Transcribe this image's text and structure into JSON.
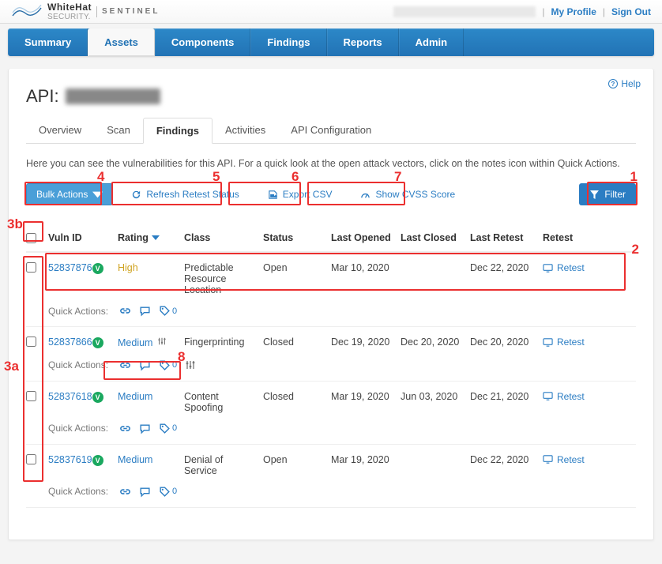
{
  "topbar": {
    "brand_name": "WhiteHat",
    "brand_sub": "SECURITY.",
    "product": "SENTINEL",
    "my_profile": "My Profile",
    "sign_out": "Sign Out"
  },
  "nav": {
    "items": [
      {
        "label": "Summary",
        "active": false
      },
      {
        "label": "Assets",
        "active": true
      },
      {
        "label": "Components",
        "active": false
      },
      {
        "label": "Findings",
        "active": false
      },
      {
        "label": "Reports",
        "active": false
      },
      {
        "label": "Admin",
        "active": false
      }
    ]
  },
  "help": {
    "label": "Help"
  },
  "page": {
    "title_prefix": "API:"
  },
  "subtabs": [
    {
      "label": "Overview",
      "active": false
    },
    {
      "label": "Scan",
      "active": false
    },
    {
      "label": "Findings",
      "active": true
    },
    {
      "label": "Activities",
      "active": false
    },
    {
      "label": "API Configuration",
      "active": false
    }
  ],
  "instructions": "Here you can see the vulnerabilities for this API. For a quick look at the open attack vectors, click on the notes icon within Quick Actions.",
  "toolbar": {
    "bulk_actions": "Bulk Actions",
    "refresh": "Refresh Retest Status",
    "export": "Export CSV",
    "cvss": "Show CVSS Score",
    "filter": "Filter"
  },
  "callouts": {
    "n1": "1",
    "n2": "2",
    "n3a": "3a",
    "n3b": "3b",
    "n4": "4",
    "n5": "5",
    "n6": "6",
    "n7": "7",
    "n8": "8"
  },
  "table": {
    "quick_actions_label": "Quick Actions:",
    "headers": {
      "vuln_id": "Vuln ID",
      "rating": "Rating",
      "class": "Class",
      "status": "Status",
      "last_opened": "Last Opened",
      "last_closed": "Last Closed",
      "last_retest": "Last Retest",
      "retest": "Retest"
    },
    "retest_label": "Retest",
    "rows": [
      {
        "id": "52837876",
        "rating": "High",
        "rating_class": "rating-high",
        "tuning": false,
        "class": "Predictable Resource Location",
        "status": "Open",
        "last_opened": "Mar 10, 2020",
        "last_closed": "",
        "last_retest": "Dec 22, 2020",
        "qa_tags": "0",
        "qa_tuning": false
      },
      {
        "id": "52837866",
        "rating": "Medium",
        "rating_class": "rating-medium",
        "tuning": true,
        "class": "Fingerprinting",
        "status": "Closed",
        "last_opened": "Dec 19, 2020",
        "last_closed": "Dec 20, 2020",
        "last_retest": "Dec 20, 2020",
        "qa_tags": "0",
        "qa_tuning": true
      },
      {
        "id": "52837618",
        "rating": "Medium",
        "rating_class": "rating-medium",
        "tuning": false,
        "class": "Content Spoofing",
        "status": "Closed",
        "last_opened": "Mar 19, 2020",
        "last_closed": "Jun 03, 2020",
        "last_retest": "Dec 21, 2020",
        "qa_tags": "0",
        "qa_tuning": false
      },
      {
        "id": "52837619",
        "rating": "Medium",
        "rating_class": "rating-medium",
        "tuning": false,
        "class": "Denial of Service",
        "status": "Open",
        "last_opened": "Mar 19, 2020",
        "last_closed": "",
        "last_retest": "Dec 22, 2020",
        "qa_tags": "0",
        "qa_tuning": false
      }
    ]
  }
}
